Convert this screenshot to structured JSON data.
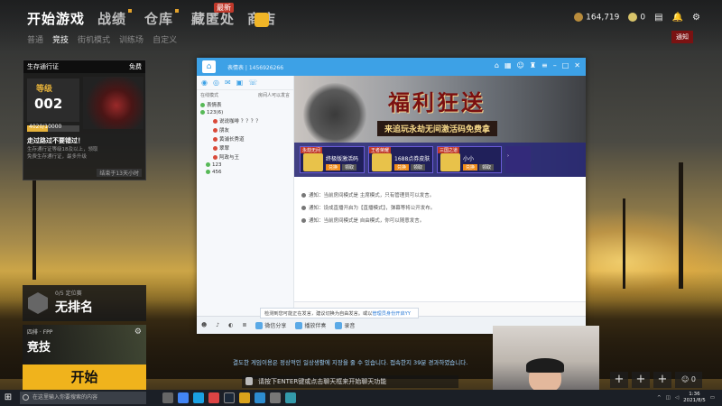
{
  "game": {
    "tabs": [
      {
        "label": "开始游戏"
      },
      {
        "label": "战绩"
      },
      {
        "label": "仓库"
      },
      {
        "label": "藏匿处"
      },
      {
        "label": "商店"
      }
    ],
    "shop_badge": "最新",
    "sub_tabs": [
      "普通",
      "竞技",
      "街机模式",
      "训练场",
      "自定义"
    ],
    "currency_bp": "164,719",
    "currency_g": "0",
    "notice_tooltip": "通知"
  },
  "pass": {
    "title": "生存通行证",
    "free_label": "免费",
    "level_label": "等级",
    "level_value": "002",
    "progress_text": "4020/10000",
    "progress_fraction": 0.4,
    "warning_title": "走过路过不要错过！",
    "description": "生存通行证等级18及以上，领取免费生存通行证，最多升级",
    "expiry": "结束于13天小时"
  },
  "rank": {
    "subtitle": "0/5 定位赛",
    "name": "无排名"
  },
  "mode": {
    "tag": "四排 · FPP",
    "name": "竞技"
  },
  "start_button": "开始",
  "chat_window": {
    "title_user": "表情表 | 1456926266",
    "left_header_left": "在线模式",
    "left_header_right": "房间人可以发言",
    "tree": [
      {
        "text": "表情表",
        "level": 0
      },
      {
        "text": "123(6)",
        "level": 0
      },
      {
        "text": "说说咖啡 ？？？？",
        "level": 2
      },
      {
        "text": "朋友",
        "level": 2
      },
      {
        "text": "黄浦长秀道",
        "level": 2
      },
      {
        "text": "翠翠",
        "level": 2
      },
      {
        "text": "阿政与王",
        "level": 2
      },
      {
        "text": "123",
        "level": 1
      },
      {
        "text": "456",
        "level": 1
      }
    ],
    "banner": {
      "title": "福利狂送",
      "subtitle": "来追玩永劫无间激活码免费拿"
    },
    "offers": [
      {
        "tag": "永劫无间",
        "name": "终极版激活码",
        "btn1": "兑换",
        "btn2": "领取"
      },
      {
        "tag": "王者荣耀",
        "name": "1688点券皮肤",
        "btn1": "兑换",
        "btn2": "领取"
      },
      {
        "tag": "三国之道",
        "name": "小小",
        "btn1": "兑换",
        "btn2": "领取"
      }
    ],
    "messages": [
      "通知：当前房间模式是 主席模式，只有管理员可以发言。",
      "通知：设成直播开启为【直播模式】，弹幕等将公开发布。",
      "通知：当前房间模式是 自由模式，你可以随意发言。"
    ],
    "tip_text": "检测到您可能正在发言，建议切换为自由发言。或以",
    "tip_link": "管理员身份开启YY",
    "bottom_buttons": [
      "微信分享",
      "播放伴奏",
      "录音"
    ]
  },
  "game_chat_line": "결도한 게임이용은 정상적인 일상생활에 지장을 줄 수 있습니다. 접속한지 39분 경과하였습니다.",
  "enter_hint": "请按下ENTER键或点击聊天框来开始聊天功能",
  "taskbar": {
    "search_placeholder": "在这里输入你要搜索的内容",
    "time": "1:36",
    "date": "2021/8/5"
  },
  "party_count": "0"
}
